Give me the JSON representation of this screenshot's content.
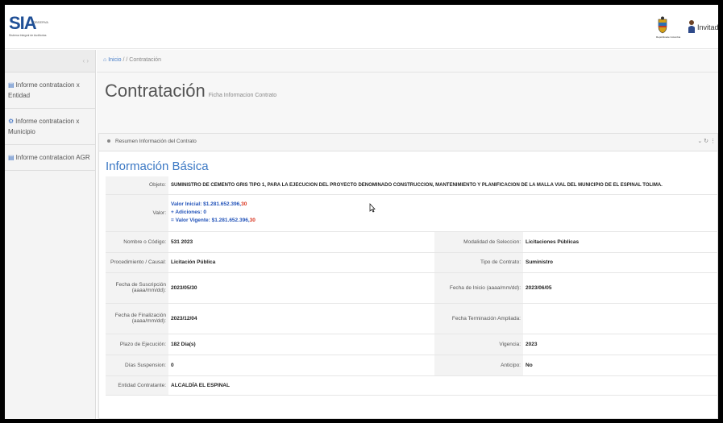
{
  "header": {
    "logo_text": "SIA",
    "logo_small": "OBSERVA",
    "logo_tagline": "Sistema Integral de Auditorias",
    "shield_caption": "Repúblicade Colombia",
    "user_name": "Invitado"
  },
  "sidebar": {
    "toggle": "‹ ›",
    "items": [
      {
        "label": "Informe contratacion x Entidad"
      },
      {
        "label": "Informe contratacion x Municipio"
      },
      {
        "label": "Informe contratacion AGR"
      }
    ]
  },
  "breadcrumb": {
    "home": "Inicio",
    "sep": "/ /",
    "current": "Contratación"
  },
  "page": {
    "title": "Contratación",
    "subtitle": "Ficha Informacion Contrato"
  },
  "panel": {
    "header": "Resumen Información del Contrato",
    "tools": "⌄ ↻ ⋮",
    "section_title": "Información Básica"
  },
  "info": {
    "objeto_label": "Objeto:",
    "objeto_value": "SUMINISTRO DE CEMENTO GRIS TIPO 1, PARA LA EJECUCION DEL PROYECTO DENOMINADO CONSTRUCCION, MANTENIMIENTO Y PLANIFICACION DE LA MALLA VIAL DEL MUNICIPIO DE EL ESPINAL TOLIMA.",
    "valor_label": "Valor:",
    "valor_inicial": "Valor Inicial: $1.281.652.396,",
    "valor_inicial_cents": "30",
    "adiciones": "+ Adiciones: 0",
    "valor_vigente": "= Valor Vigente: $1.281.652.396,",
    "valor_vigente_cents": "30",
    "nombre_label": "Nombre o Código:",
    "nombre_value": "531 2023",
    "modalidad_label": "Modalidad de Seleccion:",
    "modalidad_value": "Licitaciones Públicas",
    "procedimiento_label": "Procedimiento / Causal:",
    "procedimiento_value": "Licitación Pública",
    "tipo_label": "Tipo de Contrato:",
    "tipo_value": "Suministro",
    "suscripcion_label": "Fecha de Suscripción (aaaa/mm/dd):",
    "suscripcion_value": "2023/05/30",
    "inicio_label": "Fecha de Inicio (aaaa/mm/dd):",
    "inicio_value": "2023/06/05",
    "finalizacion_label": "Fecha de Finalización (aaaa/mm/dd):",
    "finalizacion_value": "2023/12/04",
    "terminacion_label": "Fecha Terminación Ampliada:",
    "terminacion_value": "",
    "plazo_label": "Plazo de Ejecución:",
    "plazo_value": "182 Día(s)",
    "vigencia_label": "Vigencia:",
    "vigencia_value": "2023",
    "suspension_label": "Días Suspension:",
    "suspension_value": "0",
    "anticipo_label": "Anticipo:",
    "anticipo_value": "No",
    "entidad_label": "Entidad Contratante:",
    "entidad_value": "ALCALDÍA EL ESPINAL"
  },
  "colors": {
    "link_blue": "#3b78c4",
    "value_red": "#d9341f",
    "brand_blue": "#1f4f96"
  }
}
